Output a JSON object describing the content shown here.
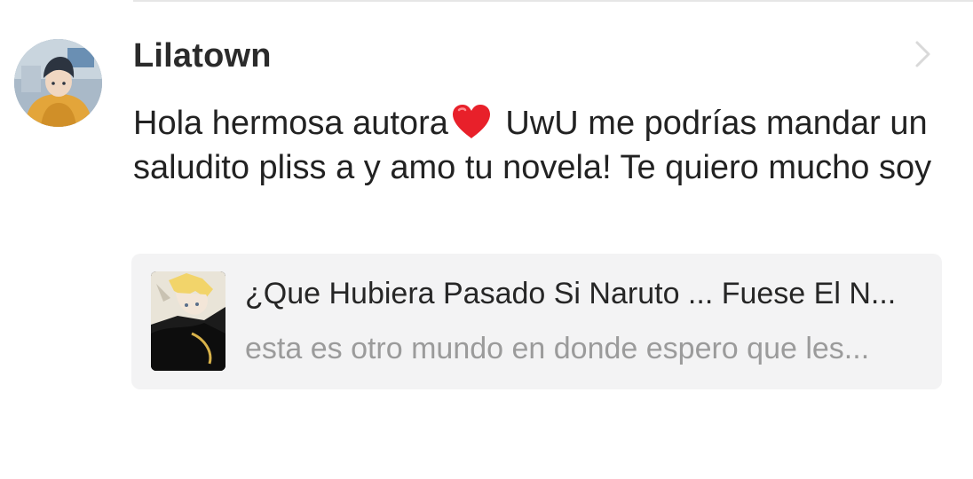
{
  "comment": {
    "username": "Lilatown",
    "text_before_heart": "Hola hermosa autora",
    "text_after_heart": " UwU me podrías mandar un saludito pliss a y amo tu novela! Te quiero mucho soy",
    "avatar_icon": "user-avatar",
    "heart_icon": "red-heart-emoji",
    "open_icon": "chevron-right-icon"
  },
  "story": {
    "title": "¿Que Hubiera Pasado Si Naruto ... Fuese El N...",
    "description": "esta es otro mundo en donde espero que les...",
    "cover_icon": "story-cover-image"
  },
  "colors": {
    "heart": "#e8202a",
    "card_background": "#f3f3f4",
    "muted_text": "#9b9b9b",
    "chevron": "#d9d9d9"
  }
}
